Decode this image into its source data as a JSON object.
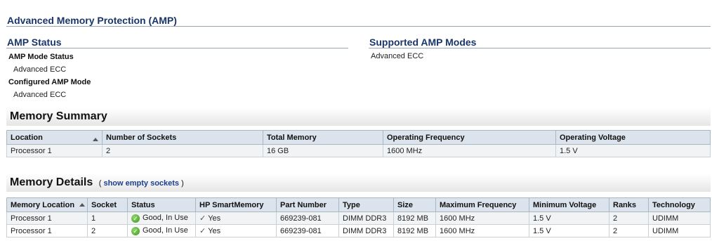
{
  "page": {
    "title": "Advanced Memory Protection (AMP)"
  },
  "amp_status": {
    "heading": "AMP Status",
    "mode_status_label": "AMP Mode Status",
    "mode_status_value": "Advanced ECC",
    "configured_label": "Configured AMP Mode",
    "configured_value": "Advanced ECC"
  },
  "supported_modes": {
    "heading": "Supported AMP Modes",
    "value": "Advanced ECC"
  },
  "memory_summary": {
    "title": "Memory Summary",
    "columns": [
      "Location",
      "Number of Sockets",
      "Total Memory",
      "Operating Frequency",
      "Operating Voltage"
    ],
    "rows": [
      [
        "Processor 1",
        "2",
        "16 GB",
        "1600 MHz",
        "1.5 V"
      ]
    ]
  },
  "memory_details": {
    "title": "Memory Details",
    "paren_open": "(",
    "paren_close": ")",
    "show_empty_link": "show empty sockets",
    "columns": [
      "Memory Location",
      "Socket",
      "Status",
      "HP SmartMemory",
      "Part Number",
      "Type",
      "Size",
      "Maximum Frequency",
      "Minimum Voltage",
      "Ranks",
      "Technology"
    ],
    "rows": [
      {
        "location": "Processor 1",
        "socket": "1",
        "status": "Good, In Use",
        "smart": "Yes",
        "part": "669239-081",
        "type": "DIMM DDR3",
        "size": "8192 MB",
        "max_freq": "1600 MHz",
        "min_volt": "1.5 V",
        "ranks": "2",
        "tech": "UDIMM"
      },
      {
        "location": "Processor 1",
        "socket": "2",
        "status": "Good, In Use",
        "smart": "Yes",
        "part": "669239-081",
        "type": "DIMM DDR3",
        "size": "8192 MB",
        "max_freq": "1600 MHz",
        "min_volt": "1.5 V",
        "ranks": "2",
        "tech": "UDIMM"
      }
    ]
  },
  "icons": {
    "status_ok": "check-circle-icon",
    "smartmemory_yes": "checkmark-icon",
    "sort": "sort-ascending-icon",
    "ok_color": "#4caf2a"
  }
}
